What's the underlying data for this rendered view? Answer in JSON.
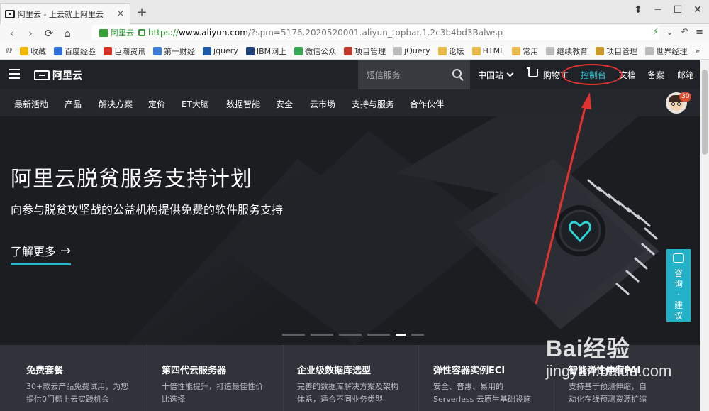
{
  "browser": {
    "tab_title": "阿里云 - 上云就上阿里云",
    "tab_close": "×",
    "new_tab": "+",
    "site_badge": "阿里云",
    "url_scheme": "https://",
    "url_host": "www.aliyun.com",
    "url_rest": "/?spm=5176.2020520001.aliyun_topbar.1.2c3b4bd3Balwsp",
    "window_controls": [
      "⬍",
      "─",
      "☐",
      "✕"
    ],
    "nav_buttons": [
      "‹",
      "›",
      "⟳",
      "⌂"
    ]
  },
  "bookmarks": [
    {
      "label": "收藏",
      "color": "#f2b705"
    },
    {
      "label": "百度经验",
      "color": "#2f6fd8"
    },
    {
      "label": "巨潮资讯",
      "color": "#d9322a"
    },
    {
      "label": "第一财经",
      "color": "#3a7bd5"
    },
    {
      "label": "jquery",
      "color": "#1c5aa8"
    },
    {
      "label": "IBM网上",
      "color": "#1d3f7a"
    },
    {
      "label": "微信公众",
      "color": "#34a853"
    },
    {
      "label": "项目管理",
      "color": "#c0392b"
    },
    {
      "label": "jQuery",
      "color": "#bbbbbb"
    },
    {
      "label": "论坛",
      "color": "#e8b84a"
    },
    {
      "label": "HTML",
      "color": "#e8b84a"
    },
    {
      "label": "常用",
      "color": "#e8b84a"
    },
    {
      "label": "继续教育",
      "color": "#bbbbbb"
    },
    {
      "label": "项目管理",
      "color": "#c89b2b"
    },
    {
      "label": "世界经理",
      "color": "#bbbbbb"
    },
    {
      "label": "»",
      "color": ""
    }
  ],
  "topnav": {
    "logo_text": "阿里云",
    "search_placeholder": "短信服务",
    "region": "中国站",
    "cart": "购物车",
    "console": "控制台",
    "docs": "文档",
    "filing": "备案",
    "mail": "邮箱"
  },
  "subnav": [
    "最新活动",
    "产品",
    "解决方案",
    "定价",
    "ET大脑",
    "数据智能",
    "安全",
    "云市场",
    "支持与服务",
    "合作伙伴"
  ],
  "avatar_badge": "30",
  "hero": {
    "title": "阿里云脱贫服务支持计划",
    "subtitle": "向参与脱贫攻坚战的公益机构提供免费的软件服务支持",
    "cta": "了解更多",
    "cta_arrow": "→"
  },
  "promos": [
    {
      "title": "免费套餐",
      "lines": [
        "30+款云产品免费试用，为您",
        "提供0门槛上云实践机会"
      ]
    },
    {
      "title": "第四代云服务器",
      "lines": [
        "十倍性能提升，打造最佳性价",
        "比选择"
      ]
    },
    {
      "title": "企业级数据库选型",
      "lines": [
        "完善的数据库解决方案及架构",
        "体系，适合不同业务类型"
      ]
    },
    {
      "title": "弹性容器实例ECI",
      "lines": [
        "安全、普惠、易用的",
        "Serverless 云原生基础设施"
      ]
    },
    {
      "title": "智能弹性伸缩PAI",
      "lines": [
        "支持基于预测伸缩，自",
        "动化在线预测资源扩缩"
      ]
    }
  ],
  "float_button": [
    "咨",
    "询",
    "·",
    "建",
    "议"
  ],
  "watermark": {
    "big": "Bai经验",
    "small": "jingyan.baidu.com"
  }
}
